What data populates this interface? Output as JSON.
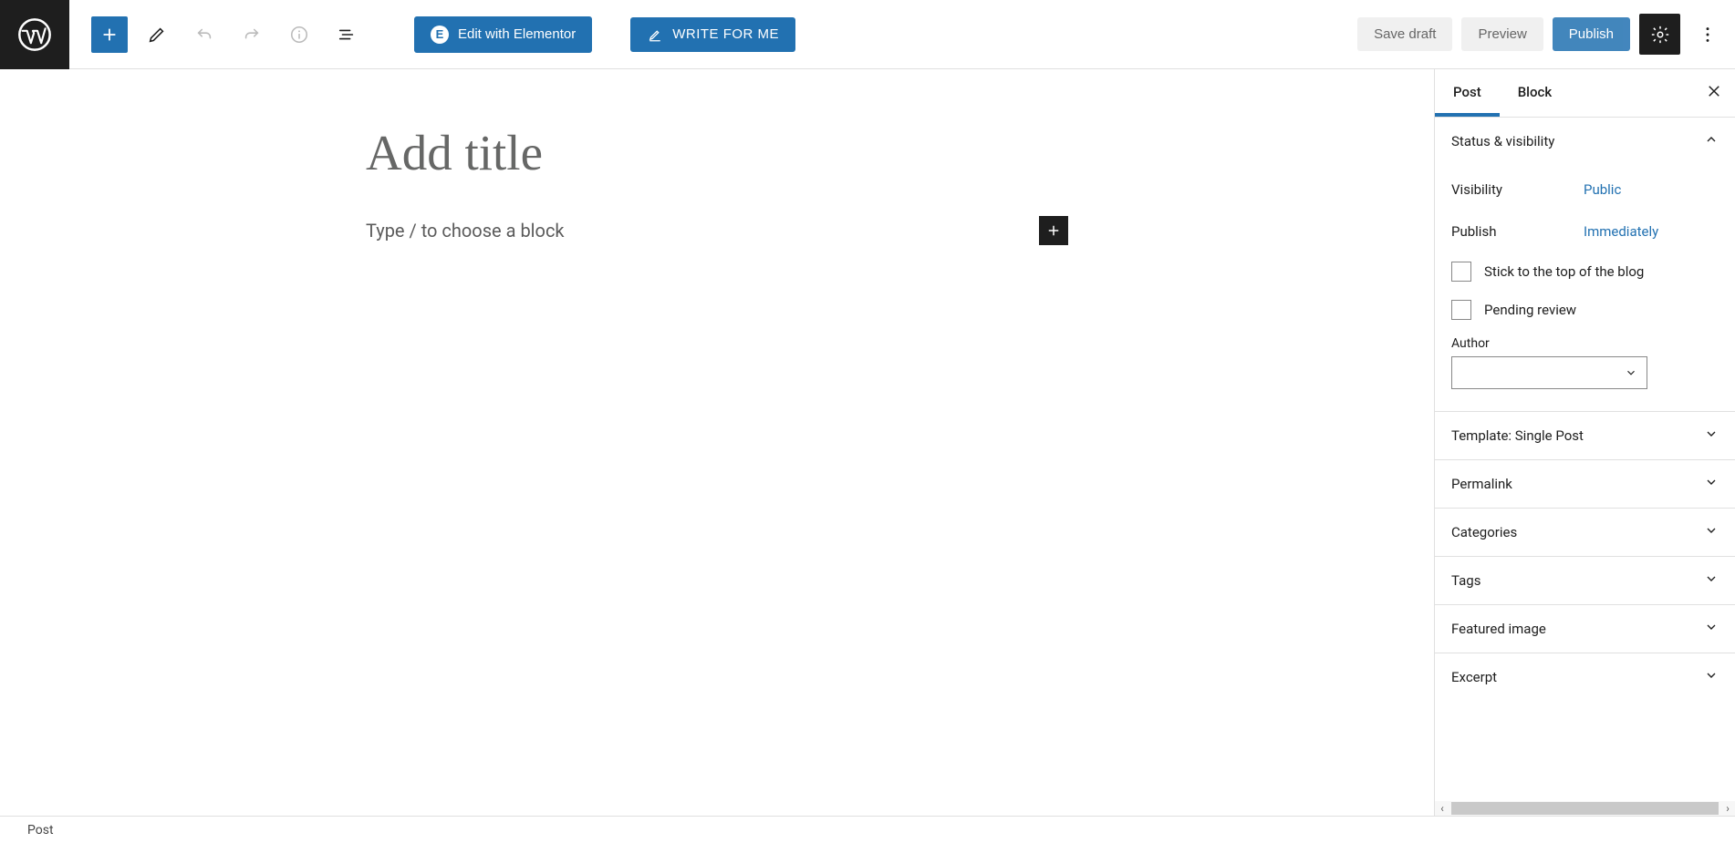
{
  "toolbar": {
    "elementor_label": "Edit with Elementor",
    "write_label": "WRITE FOR ME",
    "save_label": "Save draft",
    "preview_label": "Preview",
    "publish_label": "Publish"
  },
  "editor": {
    "title_placeholder": "Add title",
    "block_placeholder": "Type / to choose a block"
  },
  "sidebar": {
    "tabs": {
      "post": "Post",
      "block": "Block"
    },
    "panels": {
      "status": {
        "title": "Status & visibility",
        "visibility_label": "Visibility",
        "visibility_value": "Public",
        "publish_label": "Publish",
        "publish_value": "Immediately",
        "stick_label": "Stick to the top of the blog",
        "pending_label": "Pending review",
        "author_label": "Author"
      },
      "template": "Template: Single Post",
      "permalink": "Permalink",
      "categories": "Categories",
      "tags": "Tags",
      "featured": "Featured image",
      "excerpt": "Excerpt"
    }
  },
  "footer": {
    "breadcrumb": "Post"
  }
}
